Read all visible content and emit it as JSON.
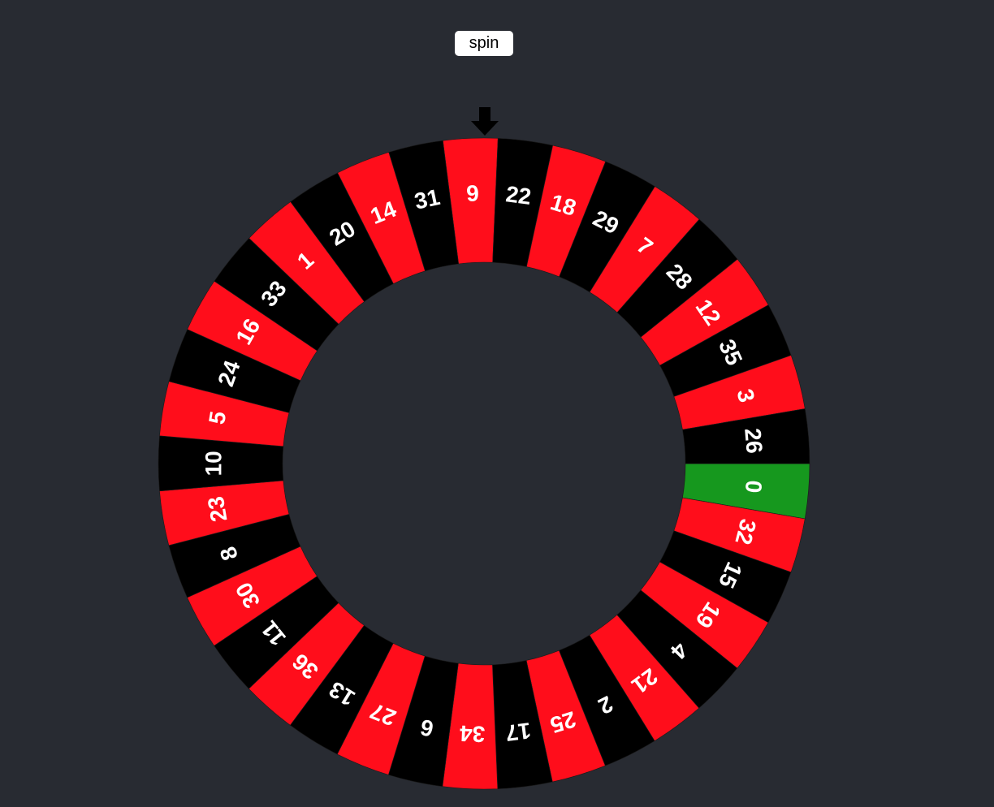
{
  "controls": {
    "spin_label": "spin"
  },
  "pointer": {
    "icon": "down-arrow-icon"
  },
  "colors": {
    "red": "#ff0d1b",
    "black": "#000000",
    "green": "#16981e",
    "background": "#282b32",
    "text": "#ffffff"
  },
  "wheel": {
    "pockets": [
      {
        "number": "9",
        "color": "red"
      },
      {
        "number": "22",
        "color": "black"
      },
      {
        "number": "18",
        "color": "red"
      },
      {
        "number": "29",
        "color": "black"
      },
      {
        "number": "7",
        "color": "red"
      },
      {
        "number": "28",
        "color": "black"
      },
      {
        "number": "12",
        "color": "red"
      },
      {
        "number": "35",
        "color": "black"
      },
      {
        "number": "3",
        "color": "red"
      },
      {
        "number": "26",
        "color": "black"
      },
      {
        "number": "0",
        "color": "green"
      },
      {
        "number": "32",
        "color": "red"
      },
      {
        "number": "15",
        "color": "black"
      },
      {
        "number": "19",
        "color": "red"
      },
      {
        "number": "4",
        "color": "black"
      },
      {
        "number": "21",
        "color": "red"
      },
      {
        "number": "2",
        "color": "black"
      },
      {
        "number": "25",
        "color": "red"
      },
      {
        "number": "17",
        "color": "black"
      },
      {
        "number": "34",
        "color": "red"
      },
      {
        "number": "6",
        "color": "black"
      },
      {
        "number": "27",
        "color": "red"
      },
      {
        "number": "13",
        "color": "black"
      },
      {
        "number": "36",
        "color": "red"
      },
      {
        "number": "11",
        "color": "black"
      },
      {
        "number": "30",
        "color": "red"
      },
      {
        "number": "8",
        "color": "black"
      },
      {
        "number": "23",
        "color": "red"
      },
      {
        "number": "10",
        "color": "black"
      },
      {
        "number": "5",
        "color": "red"
      },
      {
        "number": "24",
        "color": "black"
      },
      {
        "number": "16",
        "color": "red"
      },
      {
        "number": "33",
        "color": "black"
      },
      {
        "number": "1",
        "color": "red"
      },
      {
        "number": "20",
        "color": "black"
      },
      {
        "number": "14",
        "color": "red"
      },
      {
        "number": "31",
        "color": "black"
      }
    ]
  }
}
